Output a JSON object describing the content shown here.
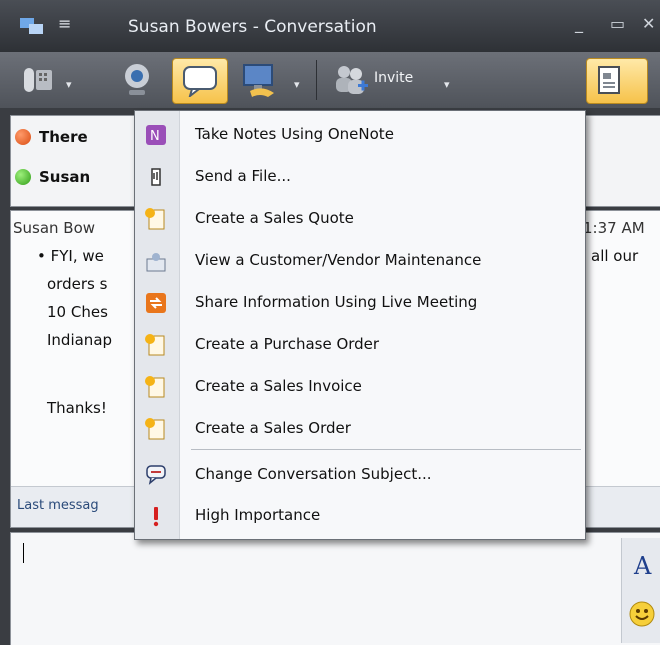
{
  "window": {
    "title": "Susan Bowers - Conversation",
    "minimize_glyph": "_",
    "maximize_glyph": "▭",
    "close_glyph": "✕",
    "menu_glyph": "≡"
  },
  "toolbar": {
    "dropdown_glyph": "▾",
    "invite_label": "Invite",
    "icons": [
      "phone-icon",
      "webcam-icon",
      "im-icon",
      "share-desktop-icon",
      "invite-icon",
      "document-icon"
    ]
  },
  "participants": [
    {
      "name": "There",
      "status_color": "#e0561f"
    },
    {
      "name": "Susan",
      "status_color": "#3cb021"
    }
  ],
  "conversation": {
    "sender": "Susan Bow",
    "time": "1:37 AM",
    "lines": [
      "• FYI, we",
      "orders s",
      "10 Ches",
      "Indianap",
      "",
      "Thanks!"
    ],
    "right_text": "all our",
    "last_message": "Last messag"
  },
  "compose": {
    "format_label": "A"
  },
  "menu": {
    "items": [
      {
        "label": "Take Notes Using OneNote",
        "icon": "onenote-icon"
      },
      {
        "label": "Send a File...",
        "icon": "send-file-icon"
      },
      {
        "label": "Create a Sales Quote",
        "icon": "sales-quote-icon"
      },
      {
        "label": "View a Customer/Vendor Maintenance",
        "icon": "customer-vendor-icon"
      },
      {
        "label": "Share Information Using Live Meeting",
        "icon": "live-meeting-icon"
      },
      {
        "label": "Create a Purchase Order",
        "icon": "purchase-order-icon"
      },
      {
        "label": "Create a Sales Invoice",
        "icon": "sales-invoice-icon"
      },
      {
        "label": "Create a Sales Order",
        "icon": "sales-order-icon"
      },
      {
        "label": "Change Conversation Subject...",
        "icon": "change-subject-icon"
      },
      {
        "label": "High Importance",
        "icon": "high-importance-icon"
      }
    ]
  }
}
